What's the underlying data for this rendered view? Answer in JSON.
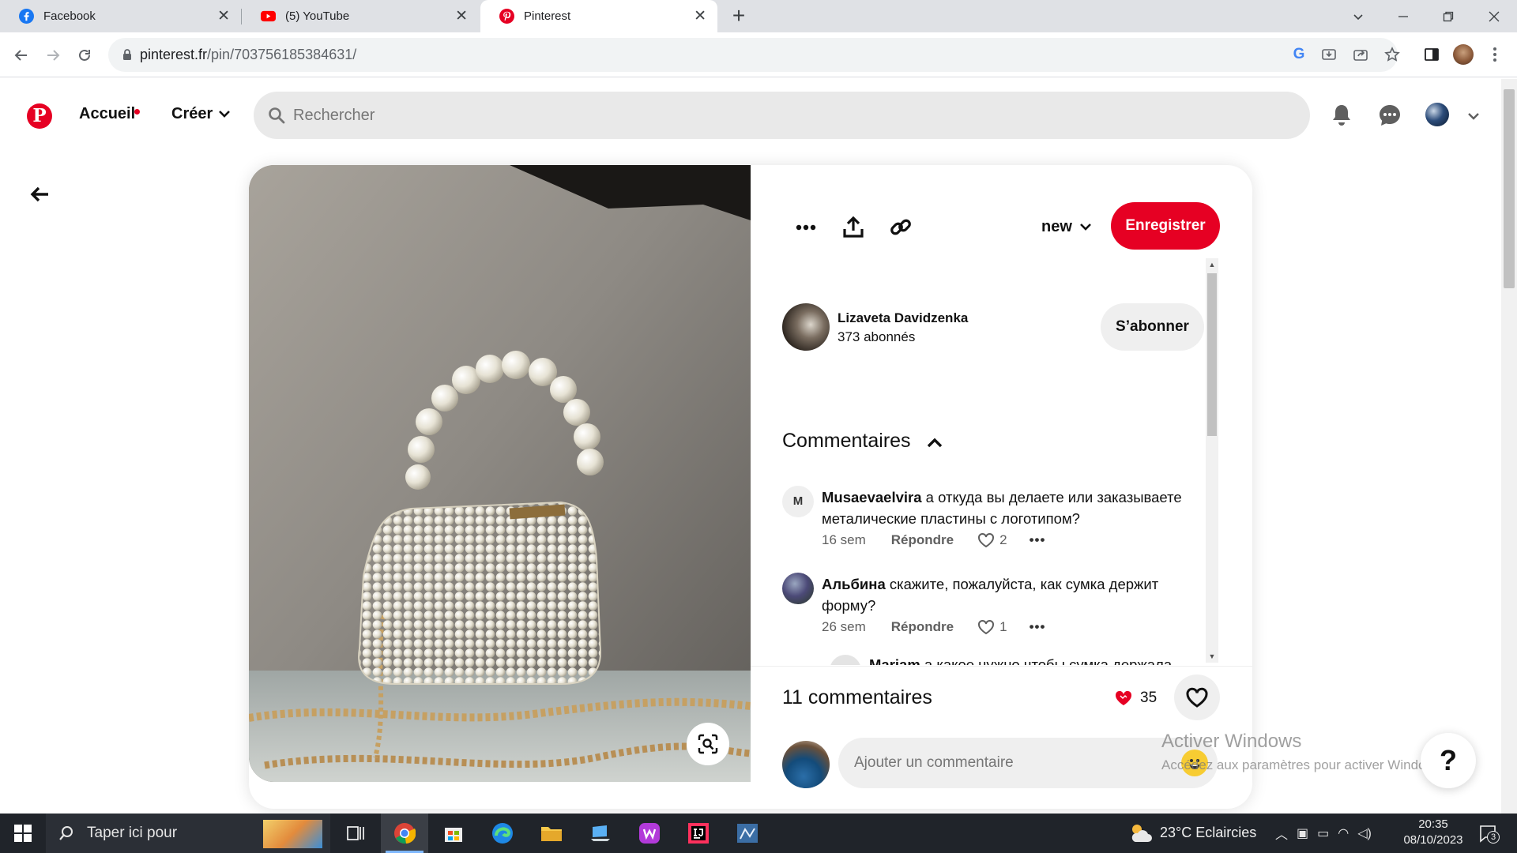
{
  "browser": {
    "tabs": [
      {
        "label": "Facebook",
        "icon": "facebook-icon"
      },
      {
        "label": "(5) YouTube",
        "icon": "youtube-icon"
      },
      {
        "label": "Pinterest",
        "icon": "pinterest-icon",
        "active": true
      }
    ],
    "url_host": "pinterest.fr",
    "url_path": "/pin/703756185384631/"
  },
  "header": {
    "home_label": "Accueil",
    "create_label": "Créer",
    "search_placeholder": "Rechercher"
  },
  "pin": {
    "board_label": "new",
    "save_label": "Enregistrer",
    "author": {
      "name": "Lizaveta Davidzenka",
      "followers": "373 abonnés"
    },
    "follow_label": "S’abonner",
    "comments_title": "Commentaires",
    "comments": [
      {
        "initial": "M",
        "user": "Musaevaelvira",
        "text": "а откуда вы делаете или заказываете металические пластины с логотипом?",
        "time": "16 sem",
        "reply_label": "Répondre",
        "likes": "2"
      },
      {
        "user": "Альбина",
        "text": "скажите, пожалуйста, как сумка держит форму?",
        "time": "26 sem",
        "reply_label": "Répondre",
        "likes": "1"
      }
    ],
    "clipped_comment": {
      "user": "Mariam",
      "text": "а какое нужно чтобы сумка держала"
    },
    "comment_count": "11 commentaires",
    "reactions": "35",
    "add_comment_placeholder": "Ajouter un commentaire"
  },
  "help_label": "?",
  "watermark": {
    "line1": "Activer Windows",
    "line2": "Accédez aux paramètres pour activer Windows."
  },
  "taskbar": {
    "search_text": "Taper ici pour",
    "weather": "23°C  Eclaircies",
    "time": "20:35",
    "date": "08/10/2023",
    "notifications": "3"
  },
  "colors": {
    "pinterest_red": "#e60023",
    "chrome_tabstrip": "#dfe1e5",
    "taskbar": "#20242a"
  }
}
